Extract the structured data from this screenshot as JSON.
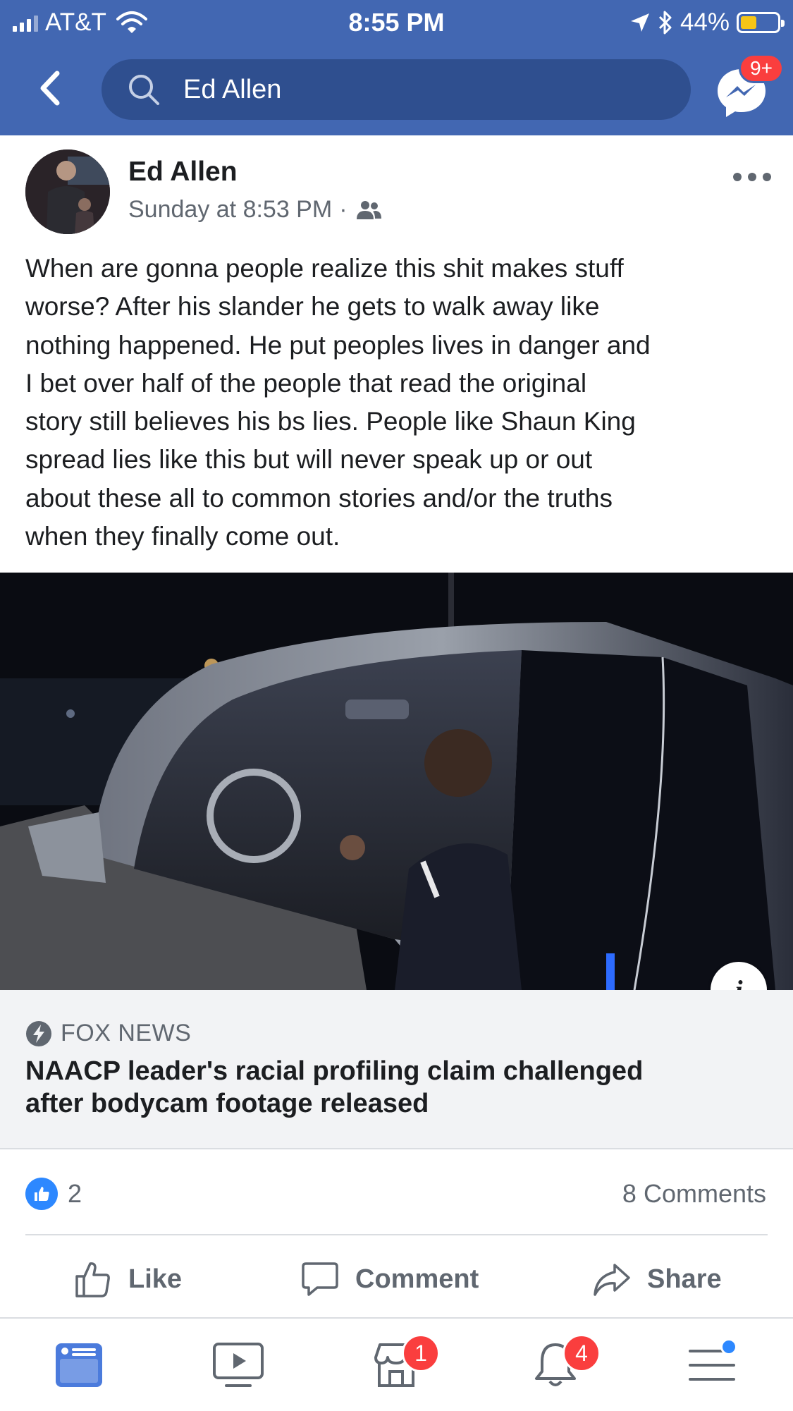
{
  "status_bar": {
    "carrier": "AT&T",
    "time": "8:55 PM",
    "battery_percent": "44%",
    "battery_level": 0.44,
    "icons": [
      "signal-icon",
      "wifi-icon",
      "location-arrow-icon",
      "bluetooth-icon",
      "battery-icon"
    ]
  },
  "header": {
    "search_value": "Ed Allen",
    "messenger_badge": "9+",
    "icons": [
      "back-chevron-icon",
      "search-icon",
      "messenger-icon"
    ]
  },
  "post": {
    "author": "Ed Allen",
    "timestamp": "Sunday at 8:53 PM",
    "separator": "·",
    "audience_icon": "friends-icon",
    "text": "When are gonna people realize this shit makes stuff\nworse? After his slander he gets to walk away like\nnothing happened. He put peoples lives in danger and\nI bet over half of the people that read the original\nstory still believes his bs lies. People like Shaun King\nspread lies like this but will never speak up or out\nabout these all to common stories and/or the truths\nwhen they finally come out."
  },
  "link_preview": {
    "source": "FOX NEWS",
    "headline": "NAACP leader's racial profiling claim challenged\nafter bodycam footage released",
    "info_glyph": "i"
  },
  "engagement": {
    "like_count": "2",
    "comments_label": "8 Comments"
  },
  "actions": {
    "like": "Like",
    "comment": "Comment",
    "share": "Share"
  },
  "tab_bar": {
    "marketplace_badge": "1",
    "notifications_badge": "4",
    "icons": [
      "news-feed-icon",
      "watch-icon",
      "marketplace-icon",
      "notifications-bell-icon",
      "menu-icon"
    ]
  },
  "colors": {
    "brand_blue": "#4267b2",
    "search_bg": "#2f4f8f",
    "badge_red": "#fa3e3e",
    "like_blue": "#2d88ff",
    "secondary_text": "#606770",
    "link_bg": "#f2f3f5"
  }
}
